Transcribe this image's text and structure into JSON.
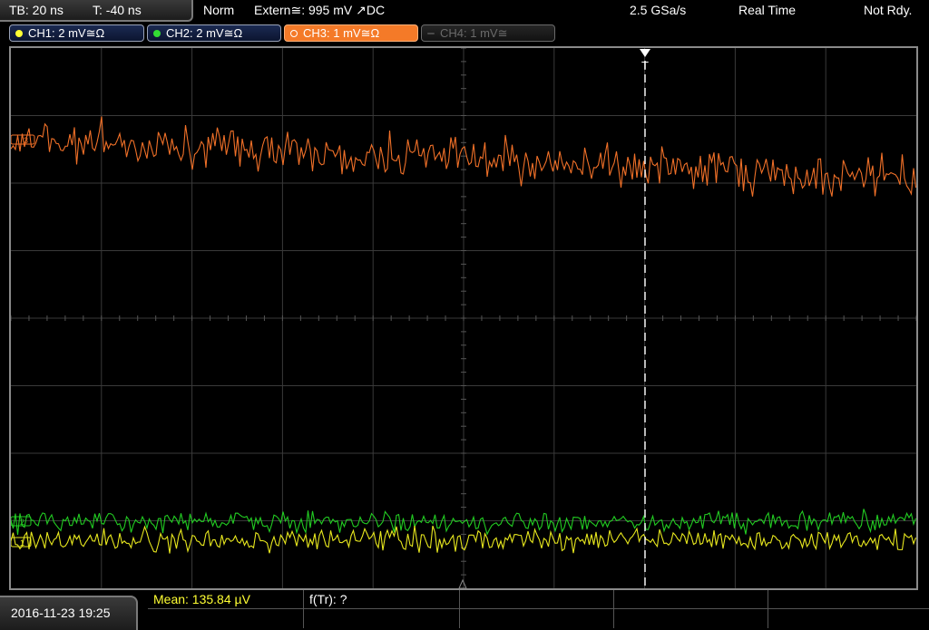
{
  "topbar": {
    "timebase": "TB: 20 ns",
    "trigger_offset": "T: -40 ns",
    "trigger_mode": "Norm",
    "trigger_source": "Extern≅: 995 mV ↗DC",
    "sample_rate": "2.5 GSa/s",
    "acquisition_mode": "Real Time",
    "status": "Not Rdy."
  },
  "channels": [
    {
      "label": "CH1: 2 mV≅Ω",
      "color": "#ffff33",
      "state": "on"
    },
    {
      "label": "CH2: 2 mV≅Ω",
      "color": "#33dd33",
      "state": "on"
    },
    {
      "label": "CH3: 1 mV≅Ω",
      "color": "#f47a28",
      "state": "selected"
    },
    {
      "label": "CH4: 1 mV≅",
      "color": "#6a6a6a",
      "state": "off"
    }
  ],
  "screen": {
    "trigger_marker": "T",
    "ch3_marker": "3",
    "ch1_marker": "1",
    "ch2_marker": "2",
    "grid_color": "#3a3a3a",
    "trace_colors": {
      "ch1": "#e8e81e",
      "ch2": "#22cc22",
      "ch3": "#f07028"
    }
  },
  "bottombar": {
    "datetime": "2016-11-23 19:25",
    "measurement_mean": "Mean: 135.84 µV",
    "measurement_freq": "f(Tr): ?"
  }
}
